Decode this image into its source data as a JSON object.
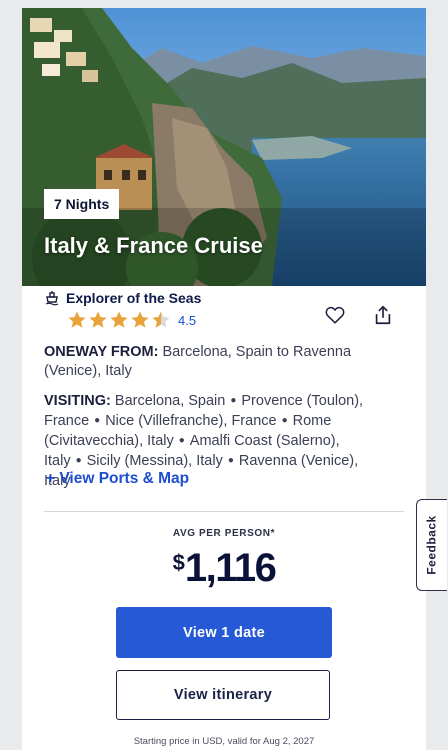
{
  "hero": {
    "nights_badge": "7 Nights",
    "title": "Italy & France Cruise",
    "image_icon": "coastal-landscape-photo"
  },
  "ship": {
    "icon": "ship-icon",
    "name": "Explorer of the Seas",
    "rating": "4.5",
    "rating_stars": 4.5,
    "max_stars": 5
  },
  "actions": {
    "favorite_icon": "heart-icon",
    "share_icon": "share-icon"
  },
  "itinerary": {
    "oneway_label": "ONEWAY FROM:",
    "oneway_value": "Barcelona, Spain to Ravenna (Venice), Italy",
    "visiting_label": "VISITING:",
    "ports": [
      "Barcelona, Spain",
      "Provence (Toulon), France",
      "Nice (Villefranche), France",
      "Rome (Civitavecchia), Italy",
      "Amalfi Coast (Salerno), Italy",
      "Sicily (Messina), Italy",
      "Ravenna (Venice), Italy"
    ],
    "view_ports_link": "+ View Ports & Map"
  },
  "pricing": {
    "avg_label": "AVG PER PERSON*",
    "currency": "$",
    "amount": "1,116",
    "footnote": "Starting price in USD, valid for Aug 2, 2027"
  },
  "buttons": {
    "primary": "View 1 date",
    "secondary": "View itinerary"
  },
  "feedback_tab": "Feedback",
  "colors": {
    "accent_blue": "#2559d5",
    "link_blue": "#1d4ed0",
    "star_gold": "#e8a33a",
    "navy": "#0b1238"
  }
}
